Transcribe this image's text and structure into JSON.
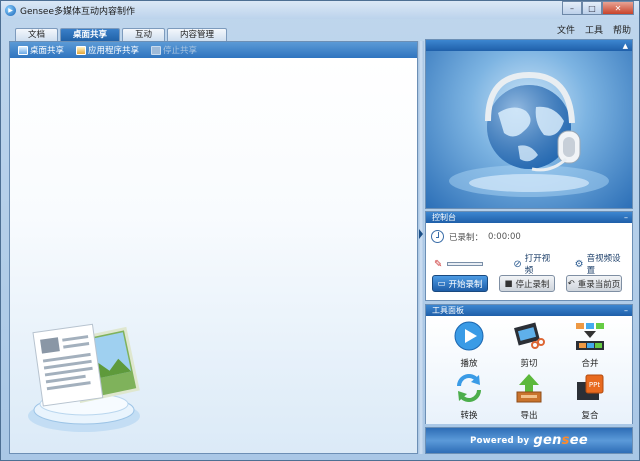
{
  "window": {
    "title": "Gensee多媒体互动内容制作",
    "controls": {
      "minimize": "–",
      "maximize": "□",
      "close": "✕"
    }
  },
  "menu": [
    "文件",
    "工具",
    "帮助"
  ],
  "tabs": [
    {
      "label": "文档",
      "active": false
    },
    {
      "label": "桌面共享",
      "active": true
    },
    {
      "label": "互动",
      "active": false
    },
    {
      "label": "内容管理",
      "active": false
    }
  ],
  "desktop_toolbar": [
    {
      "label": "桌面共享",
      "enabled": true,
      "icon": "monitor-share-icon"
    },
    {
      "label": "应用程序共享",
      "enabled": true,
      "icon": "app-share-icon"
    },
    {
      "label": "停止共享",
      "enabled": false,
      "icon": "stop-share-icon"
    }
  ],
  "video_panel": {
    "header": ""
  },
  "control_panel": {
    "header": "控制台",
    "recorded_label": "已录制：",
    "recorded_time": "0:00:00",
    "open_video": "打开视频",
    "av_settings": "音视频设置",
    "start_record": "开始录制",
    "stop_record": "停止录制",
    "rerecord_page": "重录当前页"
  },
  "tools_panel": {
    "header": "工具面板",
    "tools": [
      {
        "label": "播放",
        "icon": "play-icon"
      },
      {
        "label": "剪切",
        "icon": "film-cut-icon"
      },
      {
        "label": "合并",
        "icon": "merge-icon"
      },
      {
        "label": "转换",
        "icon": "convert-icon"
      },
      {
        "label": "导出",
        "icon": "export-icon"
      },
      {
        "label": "复合",
        "icon": "ppt-composite-icon"
      }
    ]
  },
  "footer": {
    "powered_by": "Powered by",
    "brand_a": "gen",
    "brand_b": "s",
    "brand_c": "ee"
  },
  "colors": {
    "accent": "#2f74bf",
    "header_blue": "#1f5fa9",
    "brand_orange": "#ff8a2a"
  }
}
